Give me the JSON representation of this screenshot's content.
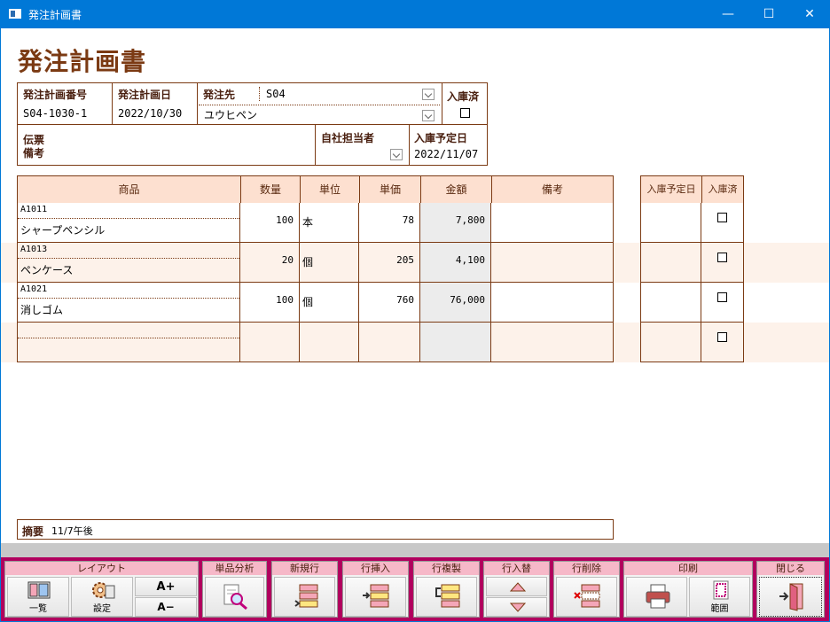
{
  "window": {
    "title": "発注計画書",
    "minimize": "—",
    "maximize": "☐",
    "close": "✕"
  },
  "heading": "発注計画書",
  "header": {
    "plan_no_label": "発注計画番号",
    "plan_no": "S04-1030-1",
    "plan_date_label": "発注計画日",
    "plan_date": "2022/10/30",
    "supplier_label": "発注先",
    "supplier_code": "S04",
    "supplier_name": "ユウヒペン",
    "received_label": "入庫済",
    "memo_label_1": "伝票",
    "memo_label_2": "備考",
    "staff_label": "自社担当者",
    "due_label": "入庫予定日",
    "due_date": "2022/11/07"
  },
  "table": {
    "columns": [
      "商品",
      "数量",
      "単位",
      "単価",
      "金額",
      "備考"
    ],
    "side_columns": [
      "入庫予定日",
      "入庫済"
    ],
    "rows": [
      {
        "code": "A1011",
        "name": "シャープペンシル",
        "qty": "100",
        "unit": "本",
        "price": "78",
        "amount": "7,800",
        "note": ""
      },
      {
        "code": "A1013",
        "name": "ペンケース",
        "qty": "20",
        "unit": "個",
        "price": "205",
        "amount": "4,100",
        "note": ""
      },
      {
        "code": "A1021",
        "name": "消しゴム",
        "qty": "100",
        "unit": "個",
        "price": "760",
        "amount": "76,000",
        "note": ""
      },
      {
        "code": "",
        "name": "",
        "qty": "",
        "unit": "",
        "price": "",
        "amount": "",
        "note": ""
      }
    ]
  },
  "summary": {
    "label": "摘要",
    "value": "11/7午後"
  },
  "toolbar": {
    "layout": {
      "title": "レイアウト",
      "list": "一覧",
      "settings": "設定",
      "font_up": "A+",
      "font_down": "A−"
    },
    "analysis": {
      "title": "単品分析"
    },
    "new_row": {
      "title": "新規行"
    },
    "insert_row": {
      "title": "行挿入"
    },
    "copy_row": {
      "title": "行複製"
    },
    "swap_row": {
      "title": "行入替"
    },
    "delete_row": {
      "title": "行削除"
    },
    "print": {
      "title": "印刷",
      "range": "範囲"
    },
    "close": {
      "title": "閉じる"
    }
  },
  "colors": {
    "accent": "#7b3a13",
    "header_bg": "#fde0d0",
    "toolbar_bg": "#b1005e",
    "toolbar_title": "#f6b8c8"
  }
}
